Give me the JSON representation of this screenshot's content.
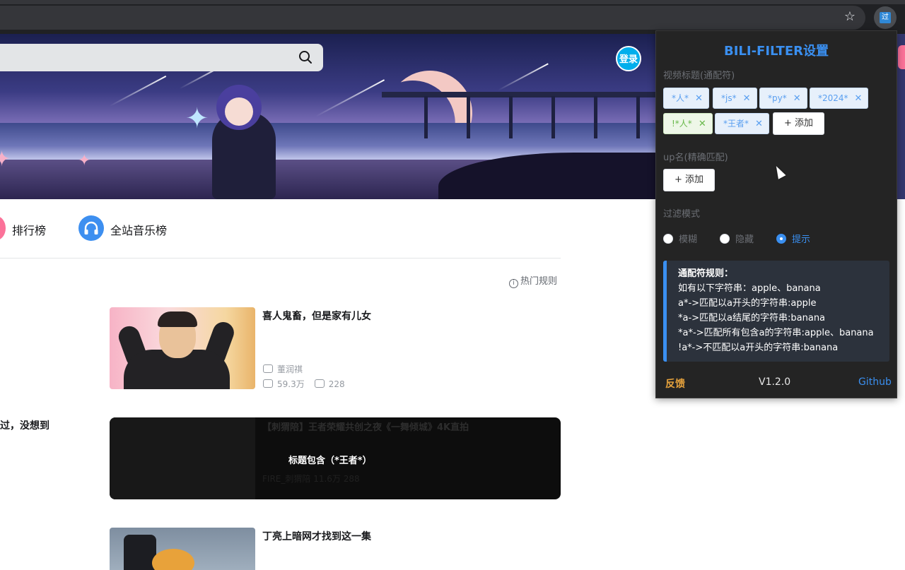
{
  "browser": {
    "star_icon": "star-icon",
    "extension_icon": "bili-filter-extension-icon",
    "extension_glyph": "过"
  },
  "header": {
    "login_label": "登录",
    "search_icon": "search-icon"
  },
  "nav": {
    "items": [
      {
        "label": "排行榜",
        "icon": "ranking-icon",
        "color": "#fb7299"
      },
      {
        "label": "全站音乐榜",
        "icon": "headphones-icon",
        "color": "#3d8ff0"
      }
    ],
    "hot_rule_label": "热门规则",
    "hot_rule_icon": "info-icon"
  },
  "videos": [
    {
      "title": "喜人鬼畜，但是家有儿女",
      "uploader": "董润祺",
      "views": "59.3万",
      "danmaku": "228"
    },
    {
      "title": "【刺猬陪】王者荣耀共创之夜《一舞倾城》4K直拍",
      "uploader": "FIRE_刺猬陪",
      "views": "11.6万",
      "danmaku": "288",
      "filtered_message": "标题包含（*王者*）"
    },
    {
      "title": "丁亮上暗网才找到这一集"
    }
  ],
  "left_cut_title": "过，没想到",
  "popup": {
    "title": "BILI-FILTER设置",
    "title_section_label": "视频标题(通配符)",
    "title_tags": [
      {
        "label": "*人*",
        "style": "blue"
      },
      {
        "label": "*js*",
        "style": "blue"
      },
      {
        "label": "*py*",
        "style": "blue"
      },
      {
        "label": "*2024*",
        "style": "blue"
      },
      {
        "label": "!*人*",
        "style": "green"
      },
      {
        "label": "*王者*",
        "style": "blue"
      }
    ],
    "add_label": "+ 添加",
    "up_section_label": "up名(精确匹配)",
    "up_add_label": "+ 添加",
    "mode_section_label": "过滤模式",
    "modes": [
      {
        "label": "模糊",
        "selected": false
      },
      {
        "label": "隐藏",
        "selected": false
      },
      {
        "label": "提示",
        "selected": true
      }
    ],
    "rules": {
      "title": "通配符规则：",
      "lines": [
        "如有以下字符串：apple、banana",
        "a*->匹配以a开头的字符串:apple",
        "*a->匹配以a结尾的字符串:banana",
        "*a*->匹配所有包含a的字符串:apple、banana",
        "!a*->不匹配以a开头的字符串:banana"
      ]
    },
    "feedback_label": "反馈",
    "version": "V1.2.0",
    "github_label": "Github",
    "accent_color": "#3a8ff0",
    "feedback_color": "#e6a23c"
  }
}
